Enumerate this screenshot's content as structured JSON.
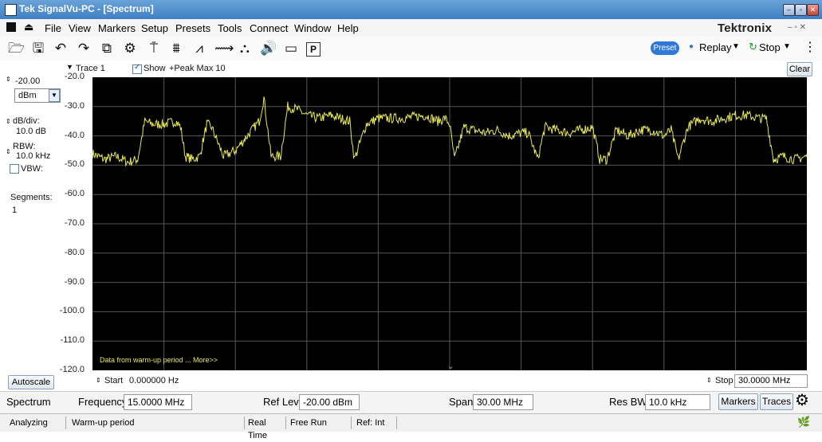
{
  "window": {
    "title": "Tek SignalVu-PC - [Spectrum]"
  },
  "menu": [
    "File",
    "View",
    "Markers",
    "Setup",
    "Presets",
    "Tools",
    "Connect",
    "Window",
    "Help"
  ],
  "brand": "Tektronix",
  "toolbar": {
    "preset_label": "Preset",
    "replay_label": "Replay",
    "stop_label": "Stop",
    "icons": [
      "open-icon",
      "save-icon",
      "undo-icon",
      "redo-icon",
      "copy-icon",
      "gear-icon",
      "trigger-icon",
      "acquire-icon",
      "analysis-icon",
      "markers-icon",
      "sweep-icon",
      "audio-icon",
      "camera-icon",
      "print-icon"
    ]
  },
  "trace": {
    "name": "Trace 1",
    "show_label": "Show",
    "detection": "+Peak Max 10",
    "clear_label": "Clear"
  },
  "left_panel": {
    "ref_level": "-20.00",
    "unit": "dBm",
    "db_div_label": "dB/div:",
    "db_div_value": "10.0 dB",
    "rbw_label": "RBW:",
    "rbw_value": "10.0 kHz",
    "vbw_label": "VBW:",
    "segments_label": "Segments:",
    "segments_value": "1",
    "autoscale_label": "Autoscale"
  },
  "plot": {
    "warmup_note": "Data from warm-up period ... More>>",
    "start_label": "Start",
    "start_value": "0.000000 Hz",
    "stop_label": "Stop",
    "stop_value": "30.0000 MHz"
  },
  "chart_data": {
    "type": "line",
    "xlim": [
      0,
      30
    ],
    "x_unit": "MHz",
    "ylim": [
      -120,
      -20
    ],
    "y_unit": "dBm",
    "yticks": [
      "-20.0",
      "-30.0",
      "-40.0",
      "-50.0",
      "-60.0",
      "-70.0",
      "-80.0",
      "-90.0",
      "-100.0",
      "-110.0",
      "-120.0"
    ],
    "grid": true,
    "trace_color": "#e8e85a",
    "series": [
      {
        "x": [
          0,
          0.5,
          1.0,
          1.5,
          1.9,
          2.2,
          2.5,
          3.0,
          3.5,
          3.7,
          3.9,
          4.2,
          4.5,
          4.8,
          5.0,
          5.5,
          6.0,
          6.5,
          7.0,
          7.2,
          7.5,
          7.9,
          8.2,
          8.6,
          9.0,
          9.5,
          10.0,
          10.4,
          10.8,
          11.0,
          11.5,
          12.0,
          13.0,
          14.0,
          14.5,
          14.8,
          15.0,
          15.2,
          15.6,
          16.0,
          16.5,
          17.0,
          17.5,
          18.0,
          18.3,
          18.7,
          19.0,
          19.5,
          20.0,
          20.5,
          21.0,
          21.3,
          21.6,
          22.0,
          22.5,
          23.0,
          23.5,
          24.0,
          24.3,
          24.6,
          25.0,
          25.5,
          26.0,
          26.5,
          27.0,
          27.5,
          28.0,
          28.3,
          28.6,
          29.0,
          29.5,
          30.0
        ],
        "y": [
          -46,
          -48,
          -47,
          -49,
          -48,
          -35,
          -36,
          -36,
          -35,
          -37,
          -47,
          -48,
          -47,
          -36,
          -37,
          -47,
          -45,
          -40,
          -35,
          -27,
          -47,
          -47,
          -30,
          -31,
          -33,
          -34,
          -33,
          -34,
          -35,
          -48,
          -36,
          -34,
          -34,
          -33,
          -35,
          -34,
          -36,
          -48,
          -37,
          -38,
          -39,
          -38,
          -40,
          -39,
          -39,
          -48,
          -37,
          -38,
          -39,
          -38,
          -37,
          -48,
          -48,
          -38,
          -40,
          -38,
          -38,
          -40,
          -38,
          -48,
          -37,
          -34,
          -35,
          -34,
          -33,
          -33,
          -34,
          -34,
          -48,
          -47,
          -48,
          -47
        ]
      }
    ]
  },
  "bottom": {
    "mode": "Spectrum",
    "freq_label": "Frequency",
    "freq_value": "15.0000 MHz",
    "reflev_label": "Ref Lev",
    "reflev_value": "-20.00 dBm",
    "span_label": "Span",
    "span_value": "30.00 MHz",
    "resbw_label": "Res BW",
    "resbw_value": "10.0 kHz",
    "markers_label": "Markers",
    "traces_label": "Traces"
  },
  "status": {
    "state": "Analyzing",
    "message": "Warm-up period",
    "realtime": "Real Time",
    "freerun": "Free Run",
    "ref": "Ref: Int"
  }
}
